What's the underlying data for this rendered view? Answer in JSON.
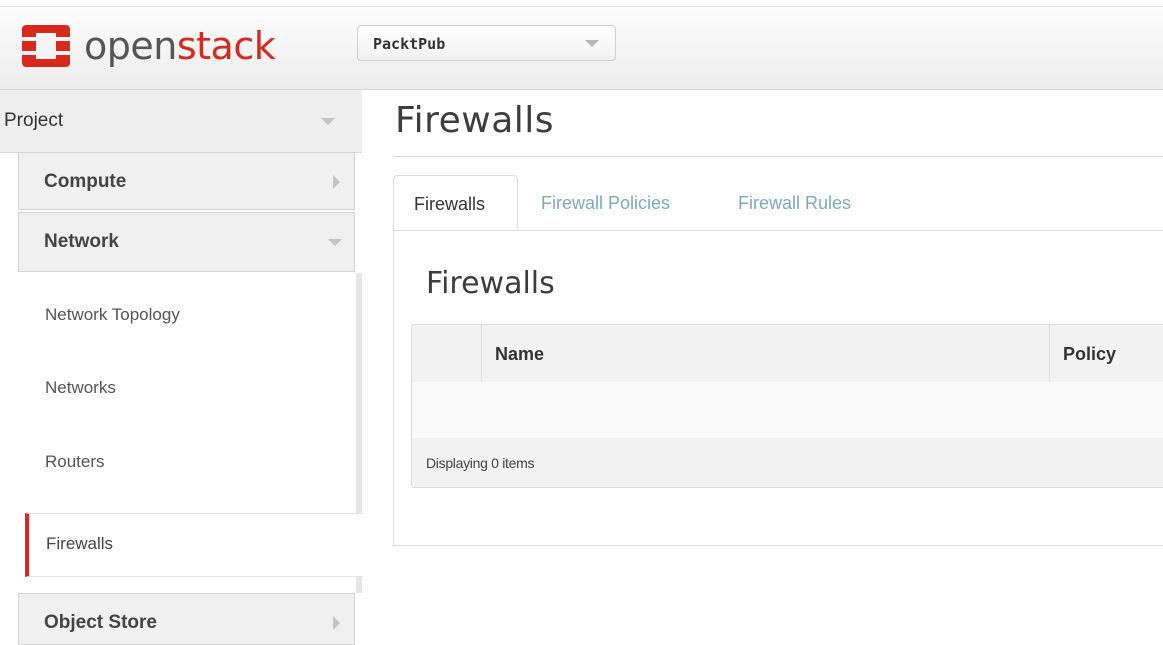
{
  "brand": {
    "logo_text_open": "open",
    "logo_text_stack": "stack",
    "accent_color": "#d72a1f"
  },
  "header": {
    "project_selector": {
      "value": "PacktPub",
      "icon": "chevron-down-icon"
    }
  },
  "sidebar": {
    "section": {
      "label": "Project",
      "icon": "chevron-down-icon"
    },
    "groups": [
      {
        "label": "Compute",
        "icon": "chevron-right-icon",
        "expanded": false
      },
      {
        "label": "Network",
        "icon": "chevron-down-icon",
        "expanded": true
      },
      {
        "label": "Object Store",
        "icon": "chevron-right-icon",
        "expanded": false
      }
    ],
    "network_items": [
      {
        "label": "Network Topology",
        "active": false
      },
      {
        "label": "Networks",
        "active": false
      },
      {
        "label": "Routers",
        "active": false
      },
      {
        "label": "Firewalls",
        "active": true
      }
    ]
  },
  "main": {
    "page_title": "Firewalls",
    "tabs": [
      {
        "label": "Firewalls",
        "active": true
      },
      {
        "label": "Firewall Policies",
        "active": false
      },
      {
        "label": "Firewall Rules",
        "active": false
      }
    ],
    "panel_title": "Firewalls",
    "table": {
      "columns": [
        "",
        "Name",
        "Policy"
      ],
      "rows": [],
      "footer": "Displaying 0 items"
    }
  }
}
